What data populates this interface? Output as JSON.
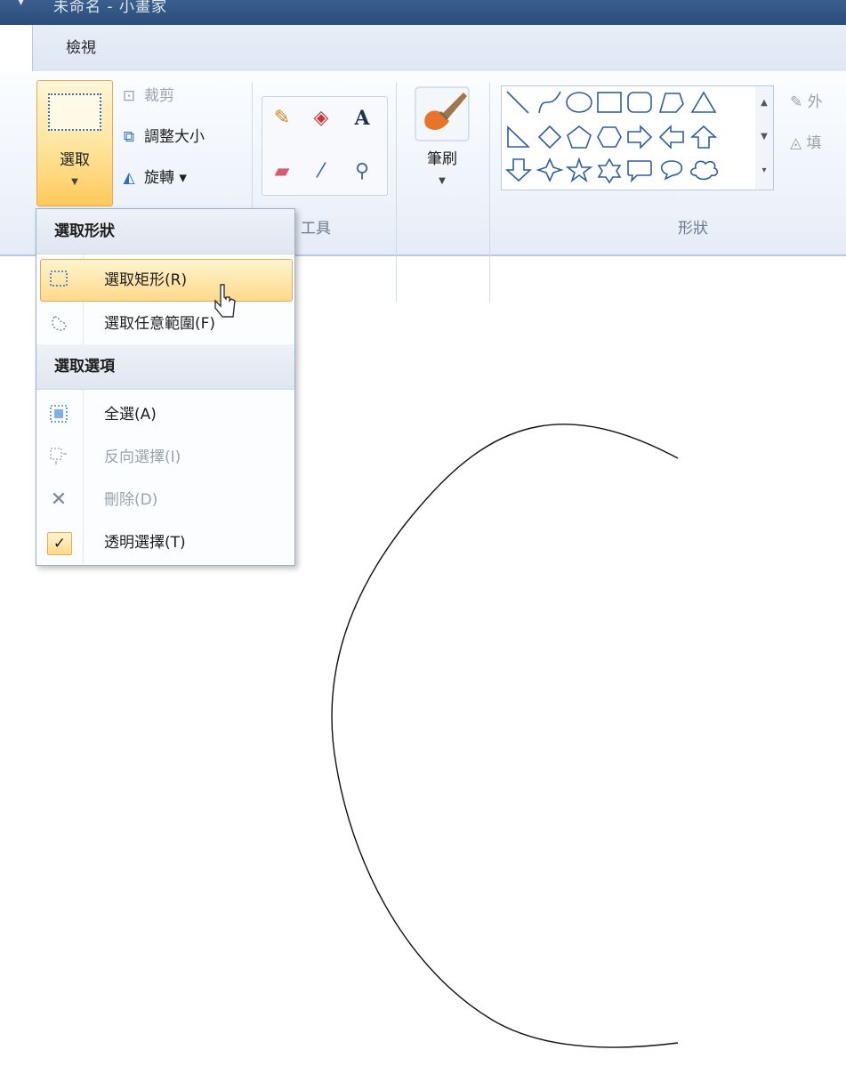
{
  "window": {
    "title": "未命名 - 小畫家"
  },
  "tabs": {
    "view": "檢視"
  },
  "image_group": {
    "select_label": "選取",
    "crop": "裁剪",
    "resize": "調整大小",
    "rotate": "旋轉 ▾"
  },
  "tools_group": {
    "label": "工具"
  },
  "brushes": {
    "label": "筆刷"
  },
  "shapes_group": {
    "label": "形狀",
    "outline": "外",
    "fill": "填"
  },
  "select_menu": {
    "section1": "選取形狀",
    "rect": "選取矩形(R)",
    "freeform": "選取任意範圍(F)",
    "section2": "選取選項",
    "select_all": "全選(A)",
    "invert": "反向選擇(I)",
    "delete": "刪除(D)",
    "transparent": "透明選擇(T)"
  },
  "colors": {
    "accent": "#ffc95c",
    "ribbon": "#eef3fa",
    "icon_blue": "#2f6fc0"
  }
}
